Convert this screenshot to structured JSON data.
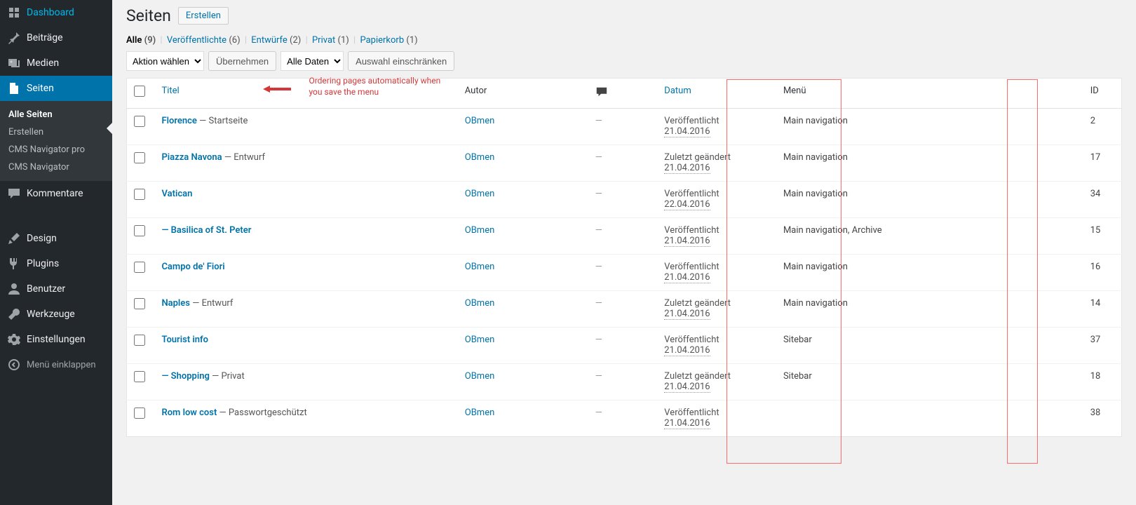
{
  "sidebar": {
    "items": [
      {
        "label": "Dashboard",
        "icon": "dashboard"
      },
      {
        "label": "Beiträge",
        "icon": "pin"
      },
      {
        "label": "Medien",
        "icon": "media"
      },
      {
        "label": "Seiten",
        "icon": "page",
        "active": true,
        "submenu": [
          {
            "label": "Alle Seiten",
            "active": true
          },
          {
            "label": "Erstellen"
          },
          {
            "label": "CMS Navigator pro"
          },
          {
            "label": "CMS Navigator"
          }
        ]
      },
      {
        "label": "Kommentare",
        "icon": "comment"
      },
      {
        "label": "Design",
        "icon": "brush"
      },
      {
        "label": "Plugins",
        "icon": "plug"
      },
      {
        "label": "Benutzer",
        "icon": "user"
      },
      {
        "label": "Werkzeuge",
        "icon": "tools"
      },
      {
        "label": "Einstellungen",
        "icon": "settings"
      }
    ],
    "collapse": "Menü einklappen"
  },
  "header": {
    "title": "Seiten",
    "new_button": "Erstellen"
  },
  "filters": {
    "all": {
      "label": "Alle",
      "count": "(9)"
    },
    "published": {
      "label": "Veröffentlichte",
      "count": "(6)"
    },
    "drafts": {
      "label": "Entwürfe",
      "count": "(2)"
    },
    "private": {
      "label": "Privat",
      "count": "(1)"
    },
    "trash": {
      "label": "Papierkorb",
      "count": "(1)"
    }
  },
  "toolbar": {
    "bulk_action": "Aktion wählen",
    "apply": "Übernehmen",
    "dates": "Alle Daten",
    "filter": "Auswahl einschränken"
  },
  "annotation": {
    "text": "Ordering pages automatically when you save the menu"
  },
  "columns": {
    "title": "Titel",
    "author": "Autor",
    "date": "Datum",
    "menu": "Menü",
    "id": "ID"
  },
  "rows": [
    {
      "title": "Florence",
      "suffix": " — Startseite",
      "author": "OBmen",
      "status": "Veröffentlicht",
      "date": "21.04.2016",
      "menu": "Main navigation",
      "id": "2"
    },
    {
      "title": "Piazza Navona",
      "suffix": " — Entwurf",
      "author": "OBmen",
      "status": "Zuletzt geändert",
      "date": "21.04.2016",
      "menu": "Main navigation",
      "id": "17"
    },
    {
      "title": "Vatican",
      "suffix": "",
      "author": "OBmen",
      "status": "Veröffentlicht",
      "date": "22.04.2016",
      "menu": "Main navigation",
      "id": "34"
    },
    {
      "prefix": "— ",
      "title": "Basilica of St. Peter",
      "suffix": "",
      "author": "OBmen",
      "status": "Veröffentlicht",
      "date": "21.04.2016",
      "menu": "Main navigation, Archive",
      "id": "15"
    },
    {
      "title": "Campo de' Fiori",
      "suffix": "",
      "author": "OBmen",
      "status": "Veröffentlicht",
      "date": "21.04.2016",
      "menu": "Main navigation",
      "id": "16"
    },
    {
      "title": "Naples",
      "suffix": " — Entwurf",
      "author": "OBmen",
      "status": "Zuletzt geändert",
      "date": "21.04.2016",
      "menu": "Main navigation",
      "id": "14"
    },
    {
      "title": "Tourist info",
      "suffix": "",
      "author": "OBmen",
      "status": "Veröffentlicht",
      "date": "21.04.2016",
      "menu": "Sitebar",
      "id": "37"
    },
    {
      "prefix": "— ",
      "title": "Shopping",
      "suffix": " — Privat",
      "author": "OBmen",
      "status": "Zuletzt geändert",
      "date": "21.04.2016",
      "menu": "Sitebar",
      "id": "18"
    },
    {
      "title": "Rom low cost",
      "suffix": " — Passwortgeschützt",
      "author": "OBmen",
      "status": "Veröffentlicht",
      "date": "21.04.2016",
      "menu": "",
      "id": "38"
    }
  ]
}
